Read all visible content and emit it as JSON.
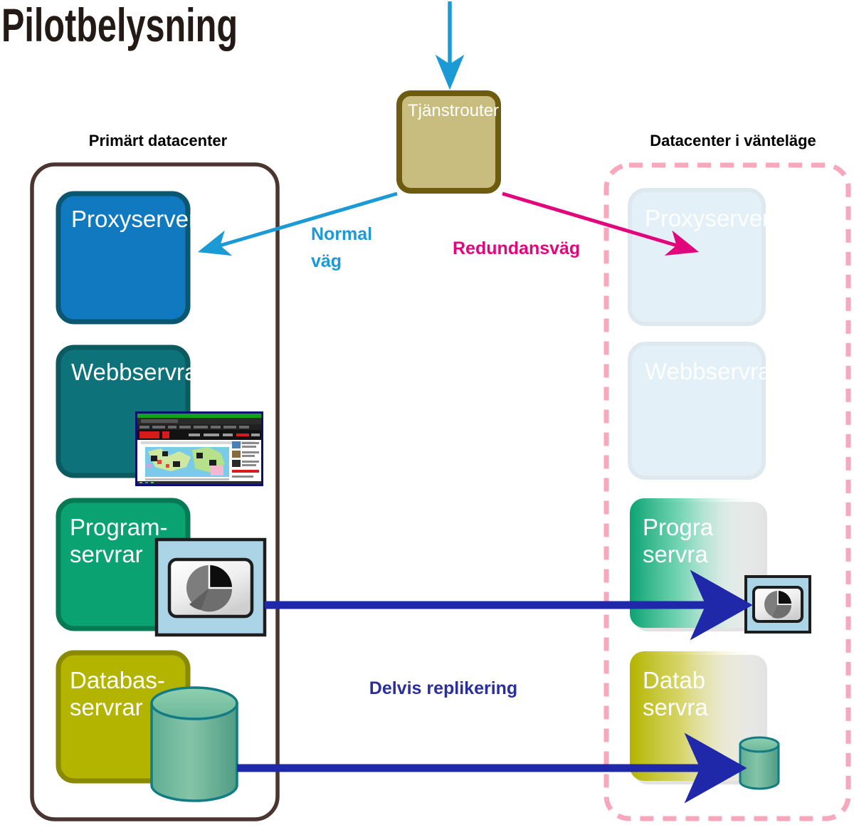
{
  "page": {
    "title": "Pilotbelysning",
    "background": "#ffffff"
  },
  "colors": {
    "title": "#231a16",
    "primary_border": "#4a3530",
    "standby_border": "#f7a8bd",
    "proxy_fill": "#1079c0",
    "proxy_stroke": "#0b5771",
    "web_fill": "#0d7279",
    "web_stroke": "#0b5a60",
    "app_fill": "#0ba271",
    "app_stroke": "#067a52",
    "db_fill": "#b3b400",
    "db_stroke": "#8a8a00",
    "router_fill": "#c8bd7e",
    "router_stroke": "#6d5c10",
    "normal_path": "#1b9ad6",
    "redundant_path": "#e2067c",
    "replication": "#1f28a8",
    "replication_label": "#2b2f9e",
    "ghost_fill": "#e3f0f7",
    "ghost_stroke": "#dde9ee",
    "cylinder_top": "#79c7a5",
    "cylinder_body": "#6fb79c",
    "cylinder_stroke": "#127b84",
    "icon_panel": "#abd4e6",
    "icon_panel_stroke": "#1d1d1d"
  },
  "headers": {
    "primary": "Primärt datacenter",
    "standby": "Datacenter i vänteläge"
  },
  "router": {
    "label": "Tjänstrouter"
  },
  "paths": {
    "normal": "Normal väg",
    "normal_line1": "Normal",
    "normal_line2": "väg",
    "redundant": "Redundansväg",
    "replication": "Delvis replikering"
  },
  "primary_nodes": [
    {
      "id": "proxyserver",
      "label": "Proxyserver",
      "label_lines": [
        "Proxyserver"
      ]
    },
    {
      "id": "webbservrar",
      "label": "Webbservrar",
      "label_lines": [
        "Webbservrar"
      ]
    },
    {
      "id": "programservrar",
      "label": "Program-servrar",
      "label_lines": [
        "Program-",
        "servrar"
      ]
    },
    {
      "id": "databasservrar",
      "label": "Databas-servrar",
      "label_lines": [
        "Databas-",
        "servrar"
      ]
    }
  ],
  "standby_nodes": [
    {
      "id": "proxyserver-standby",
      "label": "Proxyserver",
      "label_lines": [
        "Proxyserver"
      ],
      "state": "ghost"
    },
    {
      "id": "webbservrar-standby",
      "label": "Webbservrar",
      "label_lines": [
        "Webbservrar"
      ],
      "state": "ghost"
    },
    {
      "id": "programservrar-standby",
      "label": "Program-servrar",
      "label_lines": [
        "Progra",
        "servra"
      ],
      "state": "fading"
    },
    {
      "id": "databasservrar-standby",
      "label": "Databas-servrar",
      "label_lines": [
        "Datab",
        "servra"
      ],
      "state": "fading"
    }
  ],
  "icons": {
    "browser_thumbnail": "browser-window-icon",
    "pie_chart_primary": "pie-chart-icon",
    "pie_chart_standby": "pie-chart-icon",
    "database_primary": "database-cylinder-icon",
    "database_standby": "database-cylinder-icon"
  }
}
